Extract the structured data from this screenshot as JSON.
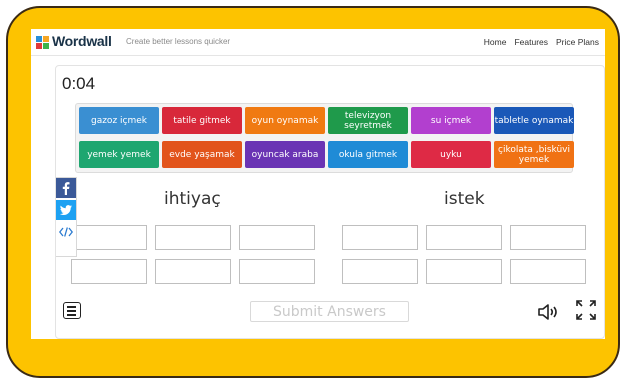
{
  "app": {
    "brand": "Wordwall",
    "tagline": "Create better lessons quicker",
    "nav": [
      "Home",
      "Features",
      "Price Plans"
    ]
  },
  "game": {
    "timer": "0:04",
    "tiles": [
      {
        "label": "gazoz içmek",
        "color": "#3a8fd2"
      },
      {
        "label": "tatile gitmek",
        "color": "#d8283a"
      },
      {
        "label": "oyun oynamak",
        "color": "#f07a12"
      },
      {
        "label": "televizyon seyretmek",
        "color": "#1f9a4b"
      },
      {
        "label": "su içmek",
        "color": "#b23fcf"
      },
      {
        "label": "tabletle oynamak",
        "color": "#1a58b8"
      },
      {
        "label": "yemek yemek",
        "color": "#1ea670"
      },
      {
        "label": "evde yaşamak",
        "color": "#e2541b"
      },
      {
        "label": "oyuncak araba",
        "color": "#6a34b4"
      },
      {
        "label": "okula gitmek",
        "color": "#1f8bd6"
      },
      {
        "label": "uyku",
        "color": "#de2a45"
      },
      {
        "label": "çikolata ,bisküvi yemek",
        "color": "#f07214"
      }
    ],
    "groups": [
      {
        "title": "ihtiyaç"
      },
      {
        "title": "istek"
      }
    ],
    "submit_label": "Submit Answers"
  },
  "icons": {
    "menu": "hamburger-menu-icon",
    "speaker": "speaker-icon",
    "fullscreen": "fullscreen-icon",
    "facebook": "facebook-icon",
    "twitter": "twitter-icon",
    "embed": "embed-code-icon"
  },
  "colors": {
    "frame": "#fdc300",
    "facebook": "#3b5998",
    "twitter": "#1da1f2",
    "embed": "#2a7ad0"
  }
}
